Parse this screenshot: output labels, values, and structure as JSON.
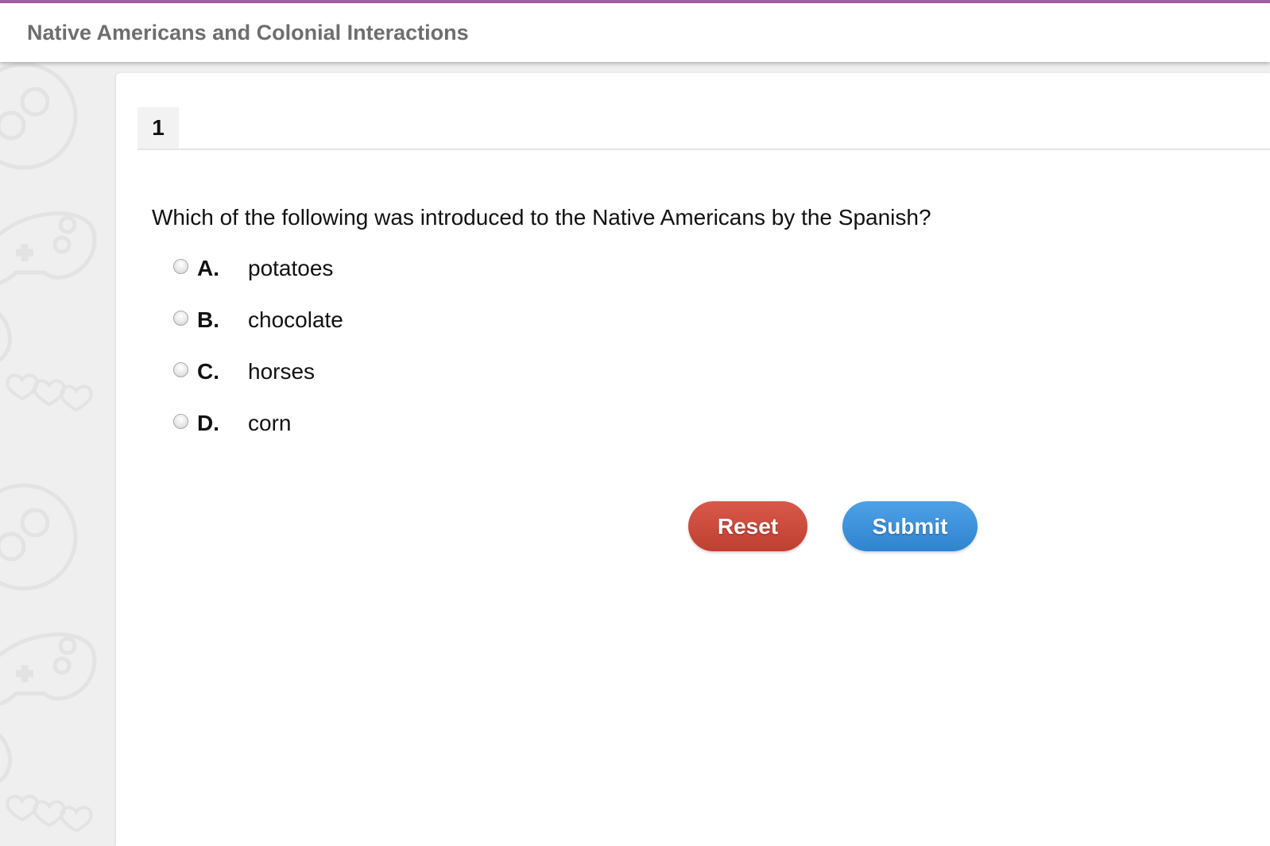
{
  "header": {
    "title": "Native Americans and Colonial Interactions",
    "accent_color": "#a35fa3"
  },
  "question": {
    "number": "1",
    "text": "Which of the following was introduced to the Native Americans by the Spanish?",
    "options": [
      {
        "letter": "A.",
        "text": "potatoes",
        "selected": false
      },
      {
        "letter": "B.",
        "text": "chocolate",
        "selected": false
      },
      {
        "letter": "C.",
        "text": "horses",
        "selected": false
      },
      {
        "letter": "D.",
        "text": "corn",
        "selected": false
      }
    ]
  },
  "buttons": {
    "reset_label": "Reset",
    "reset_color": "#c94a3b",
    "submit_label": "Submit",
    "submit_color": "#3a8fd9"
  },
  "background": {
    "pattern_icons": [
      "gamepad-icon",
      "heart-icon"
    ]
  }
}
